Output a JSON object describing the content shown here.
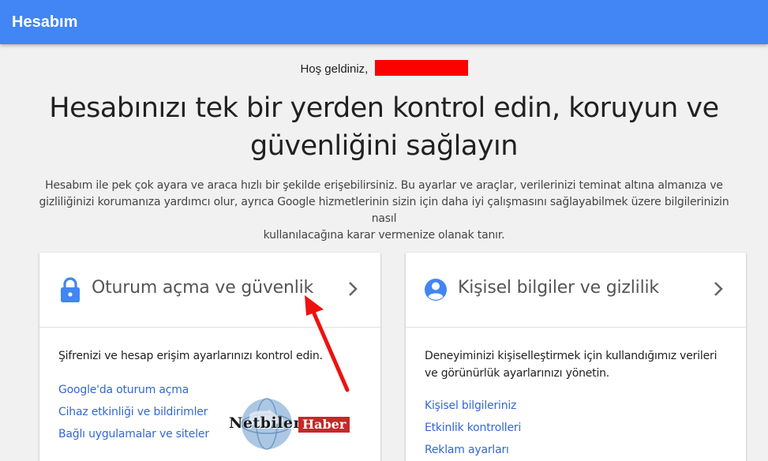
{
  "header": {
    "title": "Hesabım"
  },
  "welcome": {
    "text": "Hoş geldiniz,"
  },
  "headline": {
    "line1": "Hesabınızı tek bir yerden kontrol edin, koruyun ve",
    "line2": "güvenliğini sağlayın"
  },
  "intro": {
    "line1": "Hesabım ile pek çok ayara ve araca hızlı bir şekilde erişebilirsiniz. Bu ayarlar ve araçlar, verilerinizi teminat altına almanıza ve",
    "line2": "gizliliğinizi korumanıza yardımcı olur, ayrıca Google hizmetlerinin sizin için daha iyi çalışmasını sağlayabilmek üzere bilgilerinizin nasıl",
    "line3": "kullanılacağına karar vermenize olanak tanır."
  },
  "cards": [
    {
      "icon": "lock-icon",
      "title": "Oturum açma ve güvenlik",
      "description": "Şifrenizi ve hesap erişim ayarlarınızı kontrol edin.",
      "links": [
        "Google'da oturum açma",
        "Cihaz etkinliği ve bildirimler",
        "Bağlı uygulamalar ve siteler"
      ]
    },
    {
      "icon": "person-icon",
      "title": "Kişisel bilgiler ve gizlilik",
      "description_line1": "Deneyiminizi kişiselleştirmek için kullandığımız verileri",
      "description_line2": "ve görünürlük ayarlarınızı yönetin.",
      "links": [
        "Kişisel bilgileriniz",
        "Etkinlik kontrolleri",
        "Reklam ayarları"
      ]
    }
  ],
  "watermark": {
    "part1": "Netbilen",
    "part2": "Haber"
  },
  "colors": {
    "topbar": "#4285f4",
    "link": "#3367d6",
    "redaction": "#ff0000",
    "arrow": "#ee1111"
  }
}
